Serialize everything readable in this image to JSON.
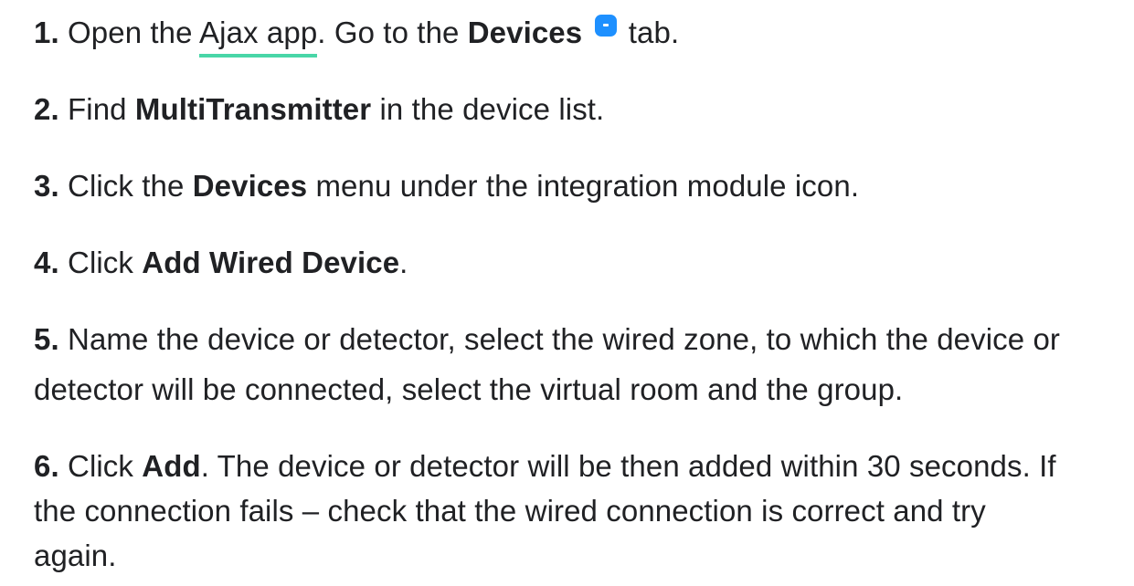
{
  "steps": [
    {
      "num": "1.",
      "parts": {
        "t1": "Open the ",
        "link": "Ajax app",
        "t2": ". Go to the ",
        "b1": "Devices",
        "t3": " tab."
      },
      "icon": "devices-tab-icon"
    },
    {
      "num": "2.",
      "parts": {
        "t1": "Find ",
        "b1": "MultiTransmitter",
        "t2": " in the device list."
      }
    },
    {
      "num": "3.",
      "parts": {
        "t1": "Click the ",
        "b1": "Devices",
        "t2": " menu under the integration module icon."
      }
    },
    {
      "num": "4.",
      "parts": {
        "t1": "Click ",
        "b1": "Add Wired Device",
        "t2": "."
      }
    },
    {
      "num": "5.",
      "parts": {
        "line1": "Name the device or detector, select the wired zone, to which the device or",
        "line2": "detector will be connected, select the virtual room and the group."
      }
    },
    {
      "num": "6.",
      "parts": {
        "t1": "Click ",
        "b1": "Add",
        "t2": ". The device or detector will be then added within 30 seconds. If",
        "line2": "the connection fails – check that the wired connection is correct and try",
        "line3": "again."
      }
    }
  ],
  "colors": {
    "text": "#202124",
    "link_underline": "#49d6a7",
    "icon_blue": "#1e90ff"
  }
}
